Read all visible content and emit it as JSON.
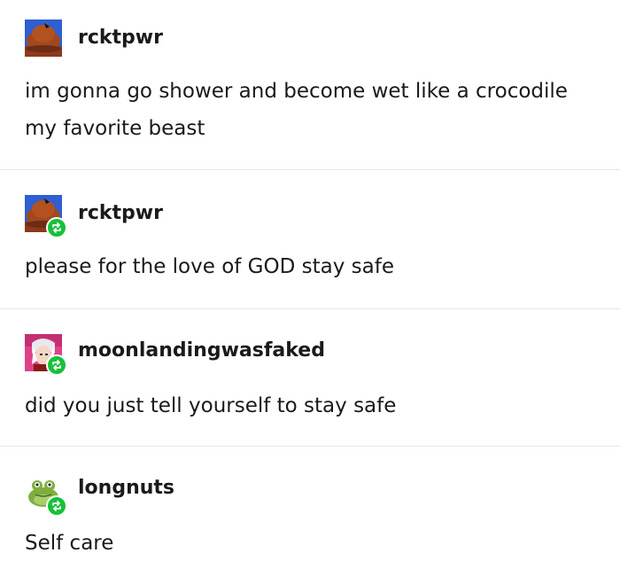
{
  "posts": [
    {
      "username": "rcktpwr",
      "avatar_icon": "hat-avatar-icon",
      "reblog": false,
      "text": "im gonna go shower and become wet like a crocodile my favorite beast"
    },
    {
      "username": "rcktpwr",
      "avatar_icon": "hat-avatar-icon",
      "reblog": true,
      "text": "please for the love of GOD stay safe"
    },
    {
      "username": "moonlandingwasfaked",
      "avatar_icon": "anime-character-avatar-icon",
      "reblog": true,
      "text": "did you just tell yourself to stay safe"
    },
    {
      "username": "longnuts",
      "avatar_icon": "frog-avatar-icon",
      "reblog": true,
      "text": "Self care"
    }
  ],
  "colors": {
    "reblog_badge": "#16c13a",
    "divider": "#e6e6e6",
    "text": "#1a1a1a"
  }
}
